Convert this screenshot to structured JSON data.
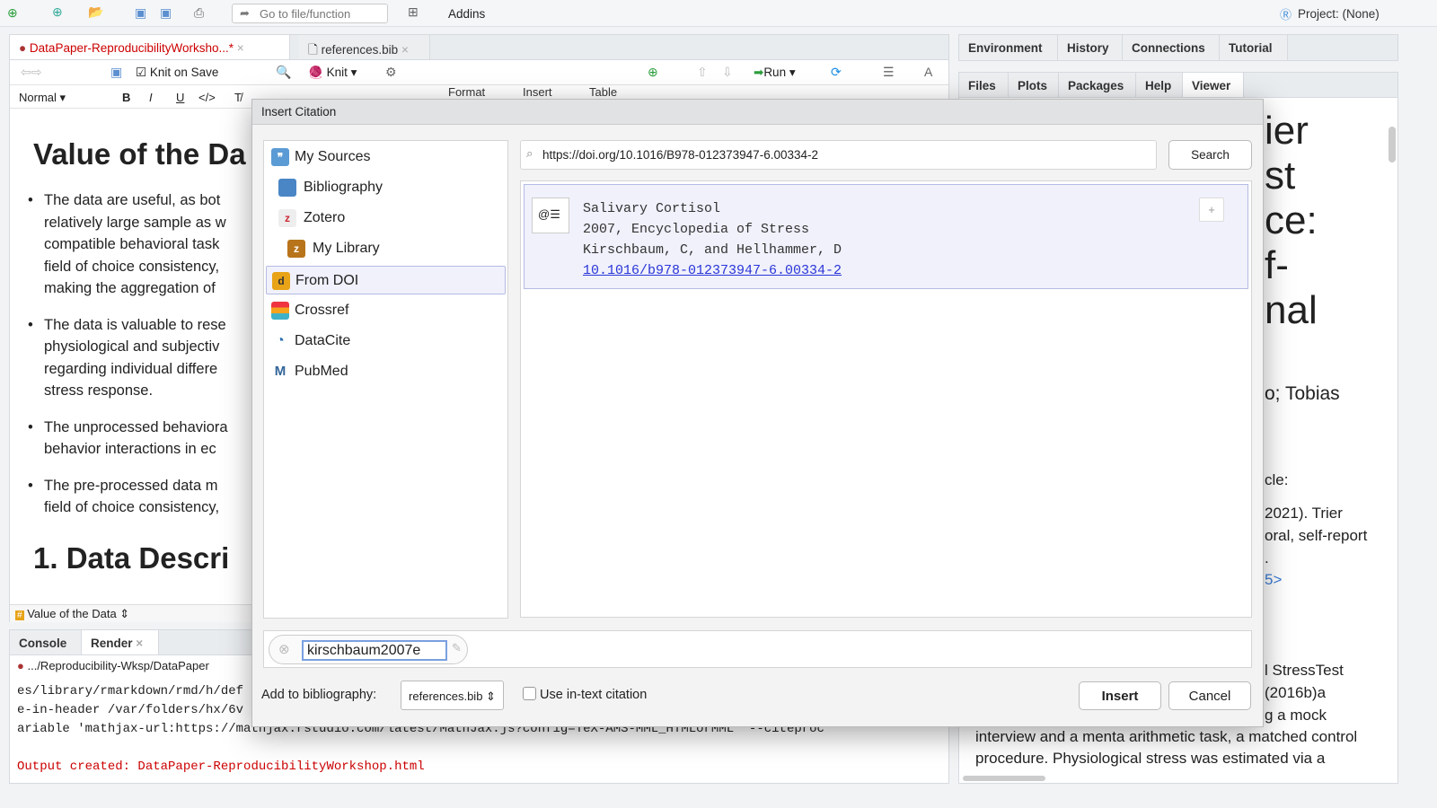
{
  "topbar": {
    "goto_placeholder": "Go to file/function",
    "addins": "Addins",
    "project": "Project: (None)"
  },
  "editor": {
    "tabs": [
      {
        "label": "DataPaper-ReproducibilityWorksho...*"
      },
      {
        "label": "references.bib"
      }
    ],
    "knit_on_save": "Knit on Save",
    "knit": "Knit",
    "run": "Run",
    "format_style": "Normal",
    "format_menus": [
      "Format",
      "Insert",
      "Table"
    ],
    "heading1": "Value of the Da",
    "bullets": [
      [
        "The data are useful, as bot",
        "relatively large sample as w",
        "compatible behavioral task",
        "field of choice consistency,",
        "making the aggregation of"
      ],
      [
        "The data is valuable to rese",
        "physiological and subjectiv",
        "regarding individual differe",
        "stress response."
      ],
      [
        "The unprocessed behaviora",
        "behavior interactions in ec"
      ],
      [
        "The pre-processed data m",
        "field of choice consistency,"
      ]
    ],
    "heading2": "1. Data Descri",
    "outline": "Value of the Data"
  },
  "console": {
    "tabs": [
      "Console",
      "Render"
    ],
    "path": ".../Reproducibility-Wksp/DataPaper",
    "lines": [
      "es/library/rmarkdown/rmd/h/def",
      "e-in-header /var/folders/hx/6v",
      "ariable 'mathjax-url:https://mathjax.rstudio.com/latest/MathJax.js?config=TeX-AMS-MML_HTMLorMML' --citeproc"
    ],
    "output": "Output created: DataPaper-ReproducibilityWorkshop.html"
  },
  "right": {
    "tabs_top": [
      "Environment",
      "History",
      "Connections",
      "Tutorial"
    ],
    "tabs_bottom": [
      "Files",
      "Plots",
      "Packages",
      "Help",
      "Viewer"
    ],
    "big": [
      "ier",
      "st",
      "ce:",
      "f-",
      "nal"
    ],
    "lines": [
      "o; Tobias",
      "cle:",
      "2021). Trier",
      "oral, self-report",
      ".",
      "5>",
      "l StressTest",
      "(2016b)a",
      "g a mock",
      "interview and a menta arithmetic task, a matched control",
      "procedure. Physiological stress was estimated via a"
    ]
  },
  "dialog": {
    "title": "Insert Citation",
    "sources": [
      {
        "label": "My Sources",
        "icon": "quote-icon",
        "color": "#5b9bd5"
      },
      {
        "label": "Bibliography",
        "icon": "book-icon",
        "color": "#4a86c5"
      },
      {
        "label": "Zotero",
        "icon": "zotero-icon",
        "color": "#cc2936"
      },
      {
        "label": "My Library",
        "icon": "folder-icon",
        "color": "#b8741a"
      },
      {
        "label": "From DOI",
        "icon": "doi-icon",
        "color": "#e8a317"
      },
      {
        "label": "Crossref",
        "icon": "crossref-icon",
        "color": "#ef3340"
      },
      {
        "label": "DataCite",
        "icon": "datacite-icon",
        "color": "#2b6cb0"
      },
      {
        "label": "PubMed",
        "icon": "pubmed-icon",
        "color": "#326599"
      }
    ],
    "selected_source": "From DOI",
    "search_value": "https://doi.org/10.1016/B978-012373947-6.00334-2",
    "search_button": "Search",
    "result": {
      "title": "Salivary Cortisol",
      "line2": "2007, Encyclopedia of Stress",
      "authors": "Kirschbaum, C, and Hellhammer, D",
      "doi": "10.1016/b978-012373947-6.00334-2",
      "add": "+"
    },
    "citekey": "kirschbaum2007e",
    "add_to_bib_label": "Add to bibliography:",
    "bib_select": "references.bib",
    "intext_label": "Use in-text citation",
    "intext_checked": false,
    "insert": "Insert",
    "cancel": "Cancel"
  }
}
